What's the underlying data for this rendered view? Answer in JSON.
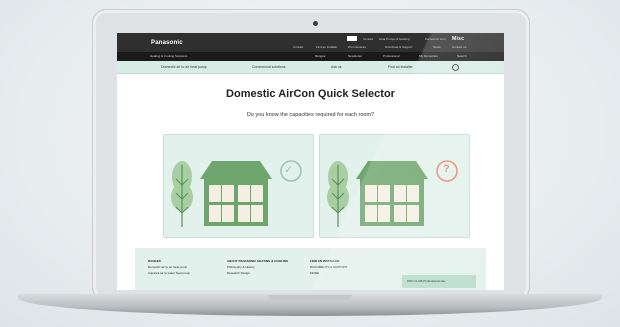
{
  "header": {
    "logo": "Panasonic",
    "top_links": [
      "Contact",
      "Find an Installer",
      "Pro Literature",
      "Download & Support",
      "News",
      "Contact us"
    ],
    "top_right_links": [
      "Heat Pumps & Heating",
      "Panasonic.com"
    ],
    "brand_mark": "Misc"
  },
  "subnav": {
    "left_label": "Heating & Cooling Solutions",
    "items": [
      "Ranges",
      "Newsletter",
      "Professional",
      "My Favourites",
      "Search"
    ]
  },
  "tabs": [
    "Domestic air to air heat pump",
    "Commercial solutions",
    "Ask us",
    "Find an installer"
  ],
  "page": {
    "title": "Domestic AirCon Quick Selector",
    "question": "Do you know the capacities required for each room?"
  },
  "cards": {
    "left_badge": "✓",
    "right_badge": "?"
  },
  "footer": {
    "col1": {
      "heading": "RANGES",
      "items": [
        "Domestic air to air heat pump",
        "Aquarea air to water heat pump"
      ]
    },
    "col2": {
      "heading": "ABOUT PANASONIC HEATING & COOLING",
      "items": [
        "Philosophy & History",
        "Research Design"
      ]
    },
    "col3": {
      "heading": "FIND AN INSTALLER",
      "items": [
        "DOCUMENTS & SUPPORT",
        "MORE"
      ]
    },
    "pro_box": "PRO CLUB Professional site"
  },
  "colors": {
    "mint": "#d6ece5",
    "card_bg": "#e3f1ec",
    "check": "#9fc2b5",
    "question": "#e98a73",
    "tree": "#a8cfa3",
    "house": "#6ea56c"
  }
}
